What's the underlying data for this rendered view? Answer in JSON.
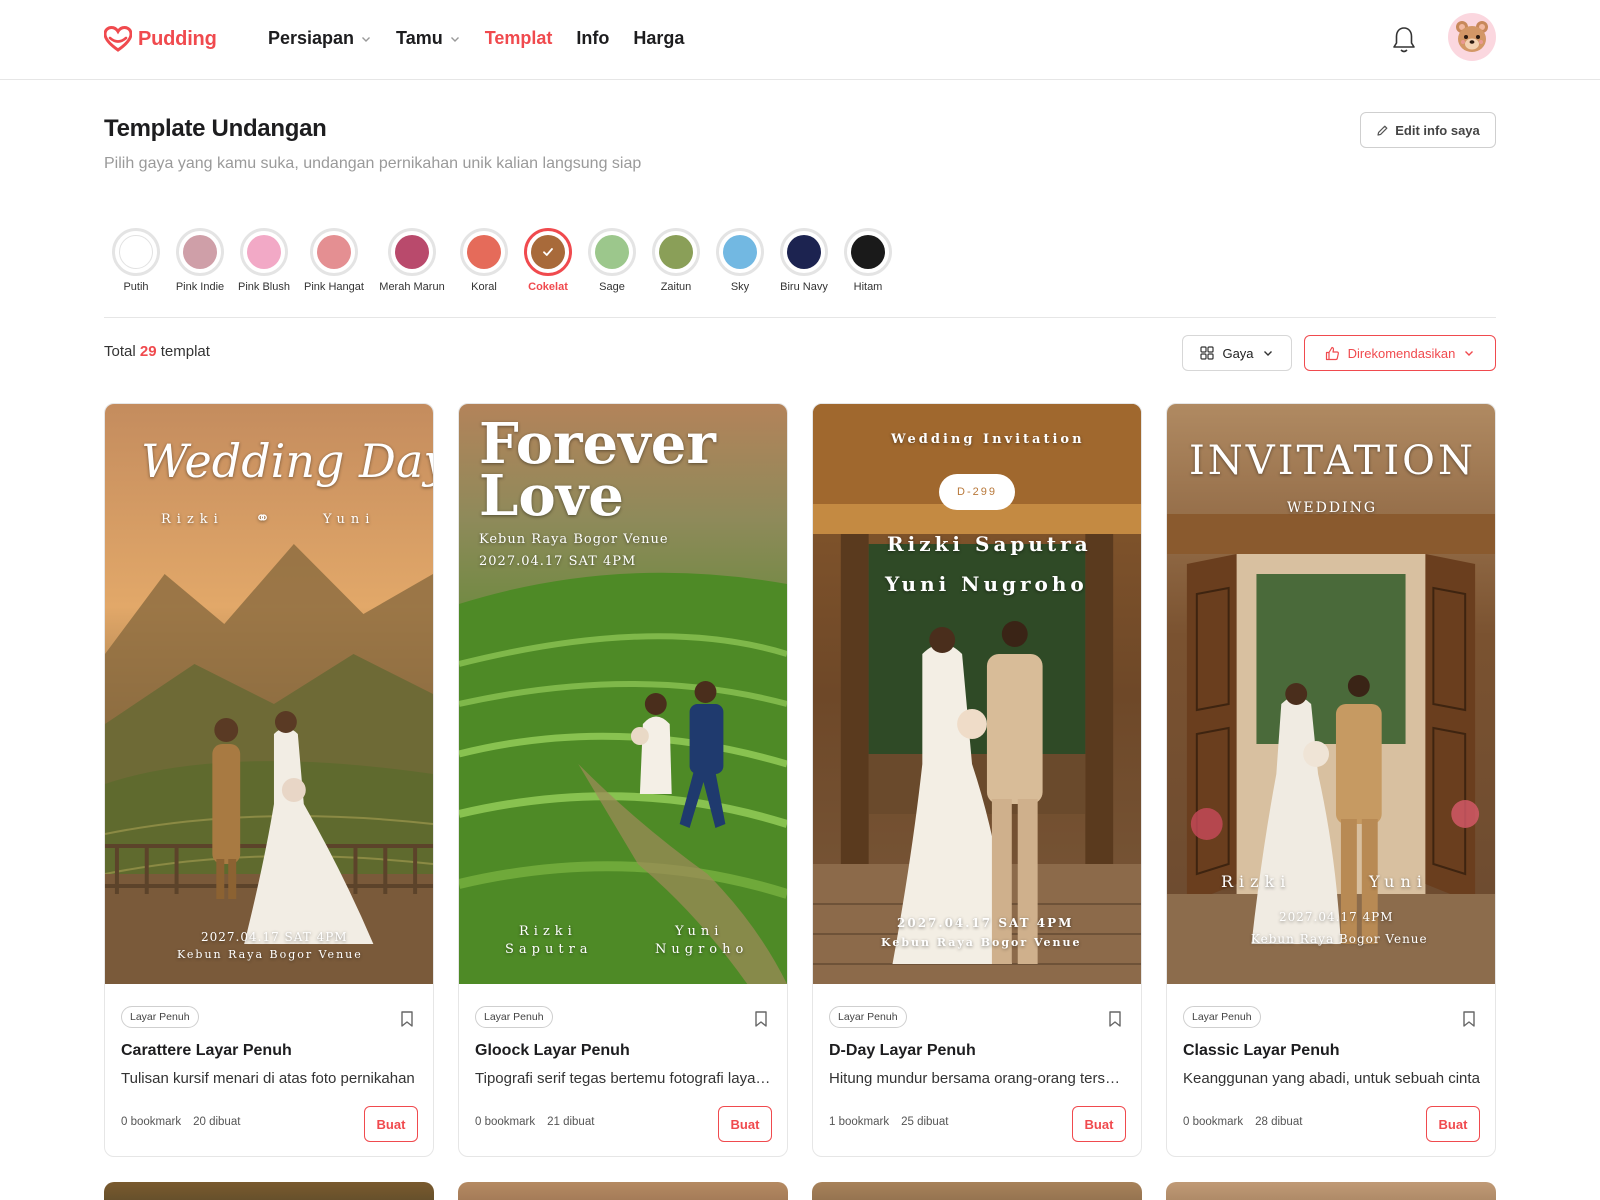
{
  "brand": {
    "name": "Pudding",
    "accent": "#f04a4e"
  },
  "nav": {
    "items": [
      {
        "label": "Persiapan",
        "has_dropdown": true,
        "active": false
      },
      {
        "label": "Tamu",
        "has_dropdown": true,
        "active": false
      },
      {
        "label": "Templat",
        "has_dropdown": false,
        "active": true
      },
      {
        "label": "Info",
        "has_dropdown": false,
        "active": false
      },
      {
        "label": "Harga",
        "has_dropdown": false,
        "active": false
      }
    ],
    "icons": [
      "bell-icon",
      "avatar-bear"
    ]
  },
  "header": {
    "title": "Template Undangan",
    "subtitle": "Pilih gaya yang kamu suka, undangan pernikahan unik kalian langsung siap",
    "edit_button": "Edit info saya"
  },
  "colors": [
    {
      "label": "Putih",
      "hex": "#ffffff",
      "selected": false
    },
    {
      "label": "Pink Indie",
      "hex": "#cf9fa8",
      "selected": false
    },
    {
      "label": "Pink Blush",
      "hex": "#f2a9c6",
      "selected": false
    },
    {
      "label": "Pink Hangat",
      "hex": "#e48f92",
      "selected": false
    },
    {
      "label": "Merah Marun",
      "hex": "#b94a6c",
      "selected": false
    },
    {
      "label": "Koral",
      "hex": "#e56b5a",
      "selected": false
    },
    {
      "label": "Cokelat",
      "hex": "#a86a3a",
      "selected": true
    },
    {
      "label": "Sage",
      "hex": "#9cc78c",
      "selected": false
    },
    {
      "label": "Zaitun",
      "hex": "#8a9f58",
      "selected": false
    },
    {
      "label": "Sky",
      "hex": "#72b8e2",
      "selected": false
    },
    {
      "label": "Biru Navy",
      "hex": "#1c2350",
      "selected": false
    },
    {
      "label": "Hitam",
      "hex": "#1a1a1a",
      "selected": false
    }
  ],
  "toolbar": {
    "total_prefix": "Total",
    "total_count": "29",
    "total_suffix": "templat",
    "style_button": "Gaya",
    "sort_button": "Direkomendasikan"
  },
  "cards": [
    {
      "tag": "Layar Penuh",
      "title": "Carattere Layar Penuh",
      "desc": "Tulisan kursif menari di atas foto pernikahan",
      "bookmarks": "0 bookmark",
      "created": "20 dibuat",
      "cta": "Buat",
      "preview": {
        "headline": "Wedding Day",
        "groom": "Rizki",
        "bride": "Yuni",
        "date": "2027.04.17 SAT 4PM",
        "venue": "Kebun Raya Bogor Venue"
      }
    },
    {
      "tag": "Layar Penuh",
      "title": "Gloock Layar Penuh",
      "desc": "Tipografi serif tegas bertemu fotografi layar penuh",
      "bookmarks": "0 bookmark",
      "created": "21 dibuat",
      "cta": "Buat",
      "preview": {
        "headline_1": "Forever",
        "headline_2": "Love",
        "venue": "Kebun Raya Bogor Venue",
        "date": "2027.04.17 SAT 4PM",
        "groom_1": "Rizki",
        "groom_2": "Saputra",
        "bride_1": "Yuni",
        "bride_2": "Nugroho"
      }
    },
    {
      "tag": "Layar Penuh",
      "title": "D-Day Layar Penuh",
      "desc": "Hitung mundur bersama orang-orang tersayang",
      "bookmarks": "1 bookmark",
      "created": "25 dibuat",
      "cta": "Buat",
      "preview": {
        "top": "Wedding Invitation",
        "countdown": "D-299",
        "groom": "Rizki Saputra",
        "bride": "Yuni Nugroho",
        "date": "2027.04.17 SAT 4PM",
        "venue": "Kebun Raya Bogor Venue"
      }
    },
    {
      "tag": "Layar Penuh",
      "title": "Classic Layar Penuh",
      "desc": "Keanggunan yang abadi, untuk sebuah cinta",
      "bookmarks": "0 bookmark",
      "created": "28 dibuat",
      "cta": "Buat",
      "preview": {
        "headline": "INVITATION",
        "sub": "WEDDING",
        "groom": "Rizki",
        "bride": "Yuni",
        "date": "2027.04.17 4PM",
        "venue": "Kebun Raya Bogor Venue"
      }
    }
  ]
}
